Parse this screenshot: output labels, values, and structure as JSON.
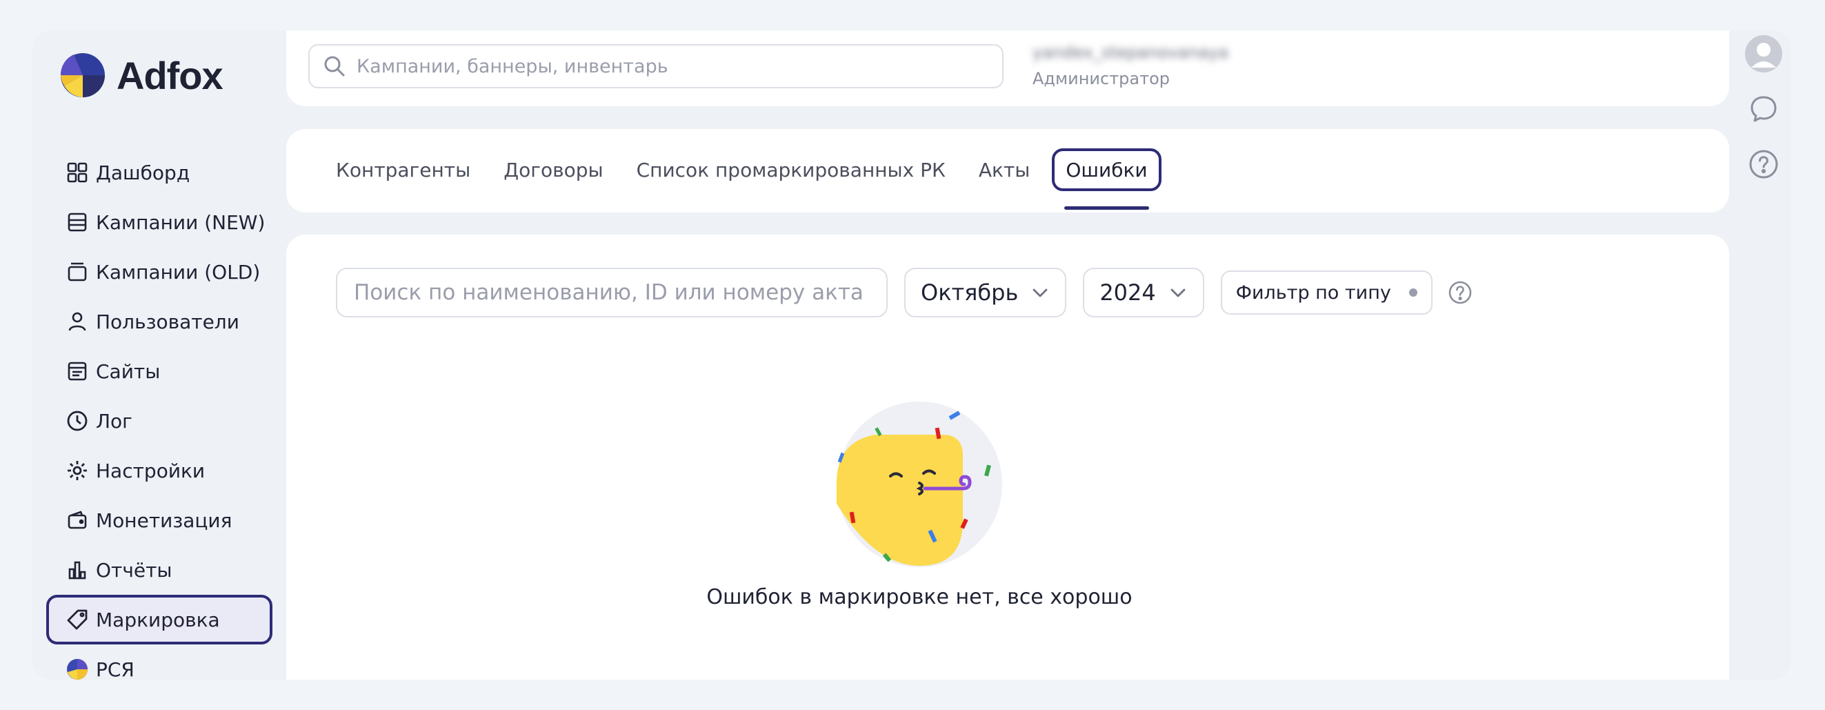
{
  "app": {
    "name": "Adfox"
  },
  "sidebar": {
    "items": [
      {
        "label": "Дашборд",
        "icon": "dashboard-icon"
      },
      {
        "label": "Кампании (NEW)",
        "icon": "campaigns-new-icon"
      },
      {
        "label": "Кампании (OLD)",
        "icon": "campaigns-old-icon"
      },
      {
        "label": "Пользователи",
        "icon": "user-icon"
      },
      {
        "label": "Сайты",
        "icon": "sites-icon"
      },
      {
        "label": "Лог",
        "icon": "clock-icon"
      },
      {
        "label": "Настройки",
        "icon": "gear-icon"
      },
      {
        "label": "Монетизация",
        "icon": "wallet-icon"
      },
      {
        "label": "Отчёты",
        "icon": "bar-chart-icon"
      },
      {
        "label": "Маркировка",
        "icon": "tag-icon",
        "active": true
      },
      {
        "label": "РСЯ",
        "icon": "rsya-icon"
      }
    ]
  },
  "header": {
    "search_placeholder": "Кампании, баннеры, инвентарь",
    "user_name": "yandex_stepanovanaya",
    "user_role": "Администратор"
  },
  "tabs": [
    {
      "label": "Контрагенты"
    },
    {
      "label": "Договоры"
    },
    {
      "label": "Список промаркированных РК"
    },
    {
      "label": "Акты"
    },
    {
      "label": "Ошибки",
      "active": true
    }
  ],
  "filters": {
    "search_placeholder": "Поиск по наименованию, ID или номеру акта",
    "month": "Октябрь",
    "year": "2024",
    "type_filter": "Фильтр по типу"
  },
  "empty_state": {
    "text": "Ошибок в маркировке нет, все хорошо",
    "icon": "party-face-icon"
  },
  "colors": {
    "accent": "#2e2b76",
    "background": "#eef1f6"
  }
}
